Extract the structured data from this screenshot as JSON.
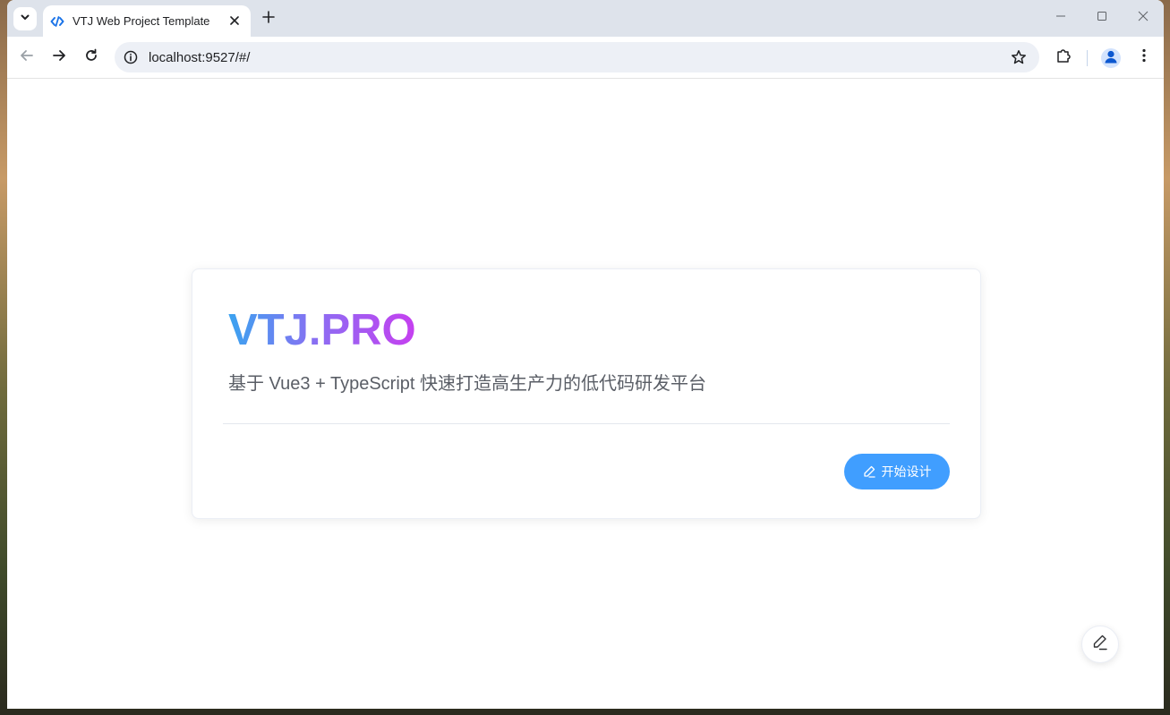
{
  "browser": {
    "tab": {
      "title": "VTJ Web Project Template",
      "favicon": "code-brackets-icon"
    },
    "address_bar": {
      "url": "localhost:9527/#/"
    },
    "icons": {
      "tab_search": "chevron-down-icon",
      "close_tab": "close-icon",
      "new_tab": "plus-icon",
      "minimize": "minimize-icon",
      "maximize": "maximize-icon",
      "close_window": "close-icon",
      "back": "arrow-left-icon",
      "forward": "arrow-right-icon",
      "reload": "reload-icon",
      "site_info": "info-icon",
      "bookmark": "star-icon",
      "extensions": "puzzle-icon",
      "profile": "profile-icon",
      "menu": "kebab-menu-icon"
    }
  },
  "page": {
    "brand": "VTJ.PRO",
    "subtitle": "基于 Vue3 + TypeScript 快速打造高生产力的低代码研发平台",
    "start_button": {
      "label": "开始设计",
      "icon": "edit-pen-icon"
    },
    "floating_button": {
      "icon": "edit-pen-icon"
    }
  },
  "colors": {
    "accent": "#409eff",
    "brand_gradient": [
      "#3ba3f0",
      "#8f6bf2",
      "#c63ff0"
    ],
    "tab_strip": "#dee3eb",
    "omnibox": "#edf0f6"
  }
}
